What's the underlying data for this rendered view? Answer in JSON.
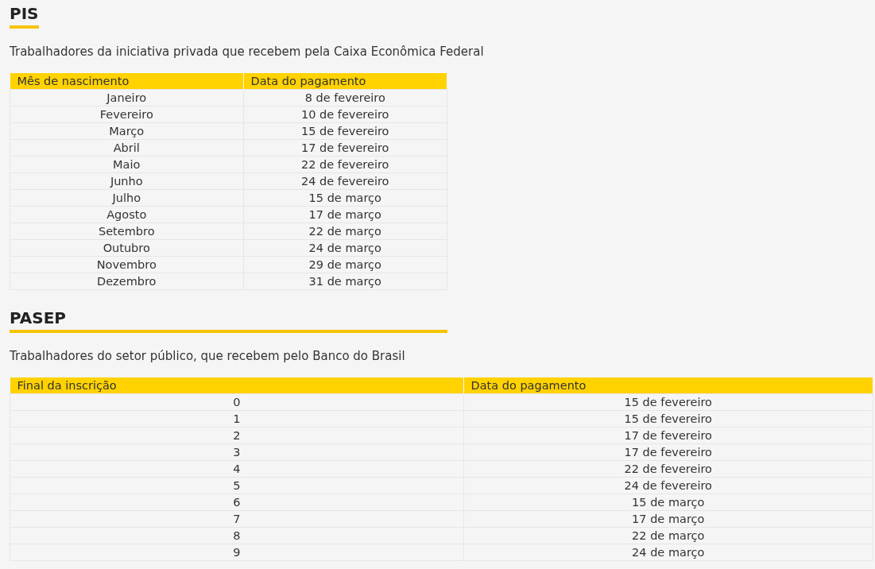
{
  "sections": [
    {
      "title": "PIS",
      "description": "Trabalhadores da iniciativa privada que recebem pela Caixa Econômica Federal",
      "table": {
        "columns": [
          "Mês de nascimento",
          "Data do pagamento"
        ],
        "rows": [
          [
            "Janeiro",
            "8 de fevereiro"
          ],
          [
            "Fevereiro",
            "10 de fevereiro"
          ],
          [
            "Março",
            "15 de fevereiro"
          ],
          [
            "Abril",
            "17 de fevereiro"
          ],
          [
            "Maio",
            "22 de fevereiro"
          ],
          [
            "Junho",
            "24 de fevereiro"
          ],
          [
            "Julho",
            "15 de março"
          ],
          [
            "Agosto",
            "17 de março"
          ],
          [
            "Setembro",
            "22 de março"
          ],
          [
            "Outubro",
            "24 de março"
          ],
          [
            "Novembro",
            "29 de março"
          ],
          [
            "Dezembro",
            "31 de março"
          ]
        ]
      }
    },
    {
      "title": "PASEP",
      "description": "Trabalhadores do setor público, que recebem pelo Banco do Brasil",
      "table": {
        "columns": [
          "Final da inscrição",
          "Data do pagamento"
        ],
        "rows": [
          [
            "0",
            "15 de fevereiro"
          ],
          [
            "1",
            "15 de fevereiro"
          ],
          [
            "2",
            "17 de fevereiro"
          ],
          [
            "3",
            "17 de fevereiro"
          ],
          [
            "4",
            "22 de fevereiro"
          ],
          [
            "5",
            "24 de fevereiro"
          ],
          [
            "6",
            "15 de março"
          ],
          [
            "7",
            "17 de março"
          ],
          [
            "8",
            "22 de março"
          ],
          [
            "9",
            "24 de março"
          ]
        ]
      }
    }
  ]
}
